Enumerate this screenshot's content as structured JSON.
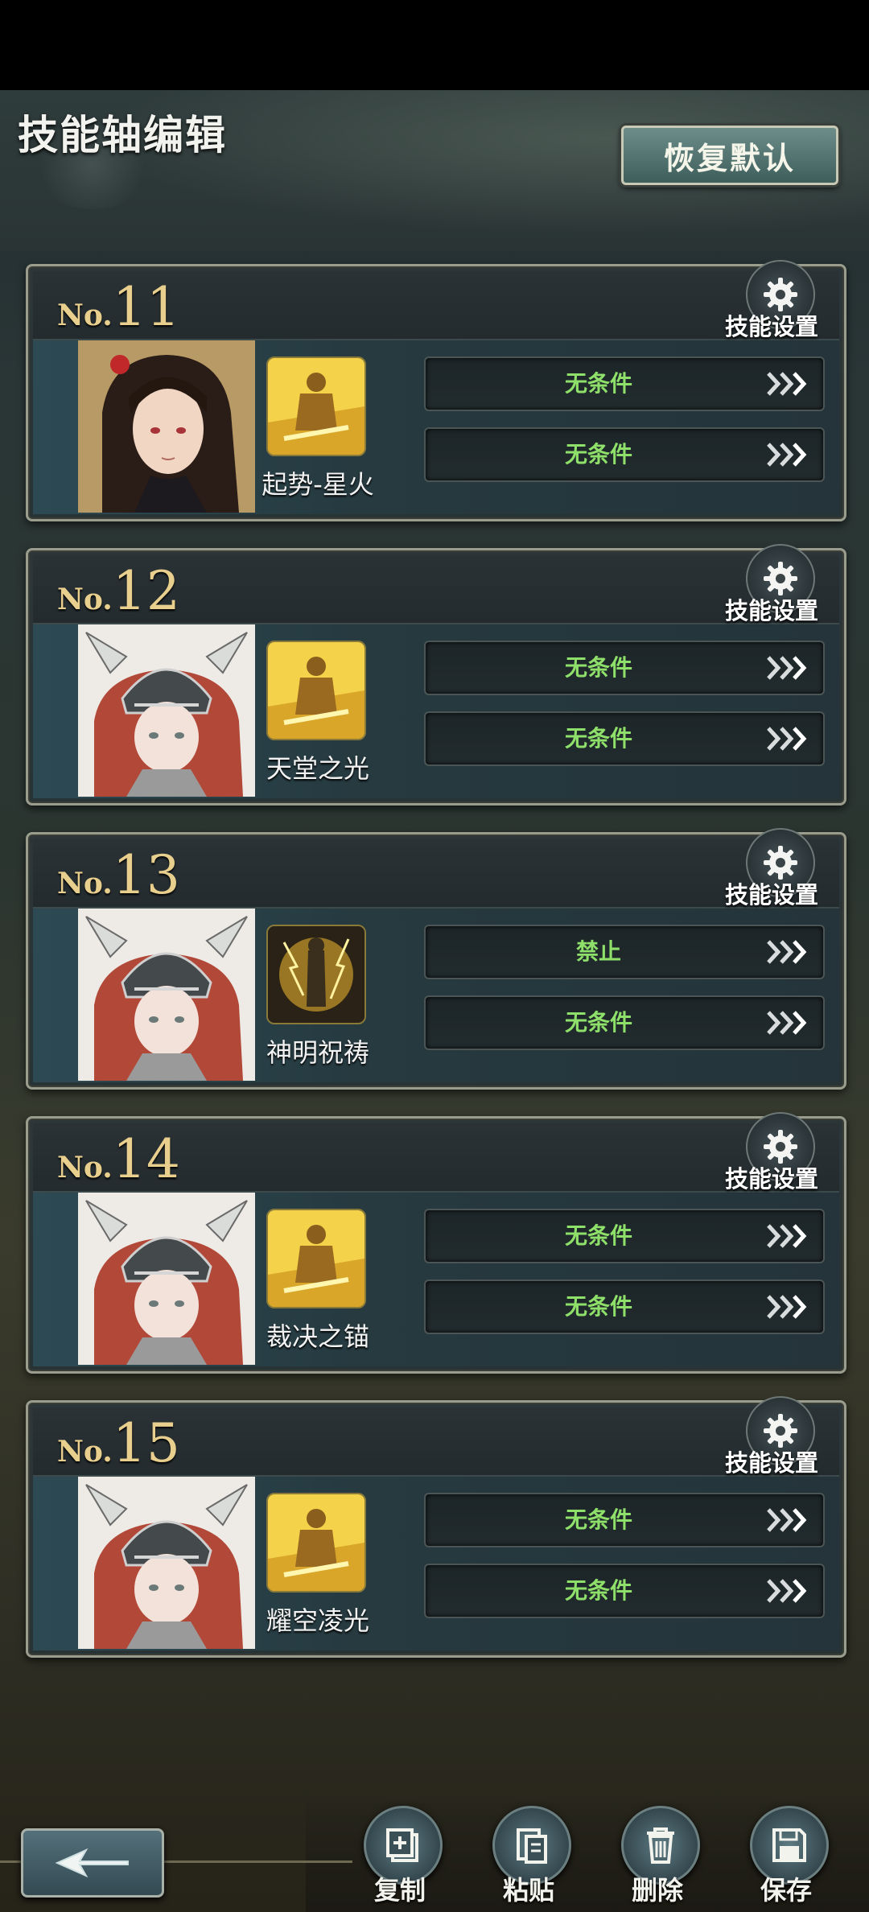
{
  "header": {
    "title": "技能轴编辑",
    "reset_label": "恢复默认"
  },
  "cards": [
    {
      "prefix": "No.",
      "number": "11",
      "settings_label": "技能设置",
      "skill_name": "起势-星火",
      "portrait": "dark-haired-woman",
      "skill_icon": "golden-knight-icon",
      "conditions": [
        "无条件",
        "无条件"
      ]
    },
    {
      "prefix": "No.",
      "number": "12",
      "settings_label": "技能设置",
      "skill_name": "天堂之光",
      "portrait": "red-haired-valkyrie",
      "skill_icon": "golden-knight-icon",
      "conditions": [
        "无条件",
        "无条件"
      ]
    },
    {
      "prefix": "No.",
      "number": "13",
      "settings_label": "技能设置",
      "skill_name": "神明祝祷",
      "portrait": "red-haired-valkyrie",
      "skill_icon": "lightning-prayer-icon",
      "conditions": [
        "禁止",
        "无条件"
      ]
    },
    {
      "prefix": "No.",
      "number": "14",
      "settings_label": "技能设置",
      "skill_name": "裁决之锚",
      "portrait": "red-haired-valkyrie",
      "skill_icon": "golden-knight-icon",
      "conditions": [
        "无条件",
        "无条件"
      ]
    },
    {
      "prefix": "No.",
      "number": "15",
      "settings_label": "技能设置",
      "skill_name": "耀空凌光",
      "portrait": "red-haired-valkyrie",
      "skill_icon": "golden-knight-icon",
      "conditions": [
        "无条件",
        "无条件"
      ]
    }
  ],
  "toolbar": {
    "copy_label": "复制",
    "paste_label": "粘贴",
    "delete_label": "删除",
    "save_label": "保存"
  },
  "colors": {
    "accent_gold": "#e8cf8e",
    "condition_green": "#8ee06a",
    "frame": "#9a9d8d"
  }
}
